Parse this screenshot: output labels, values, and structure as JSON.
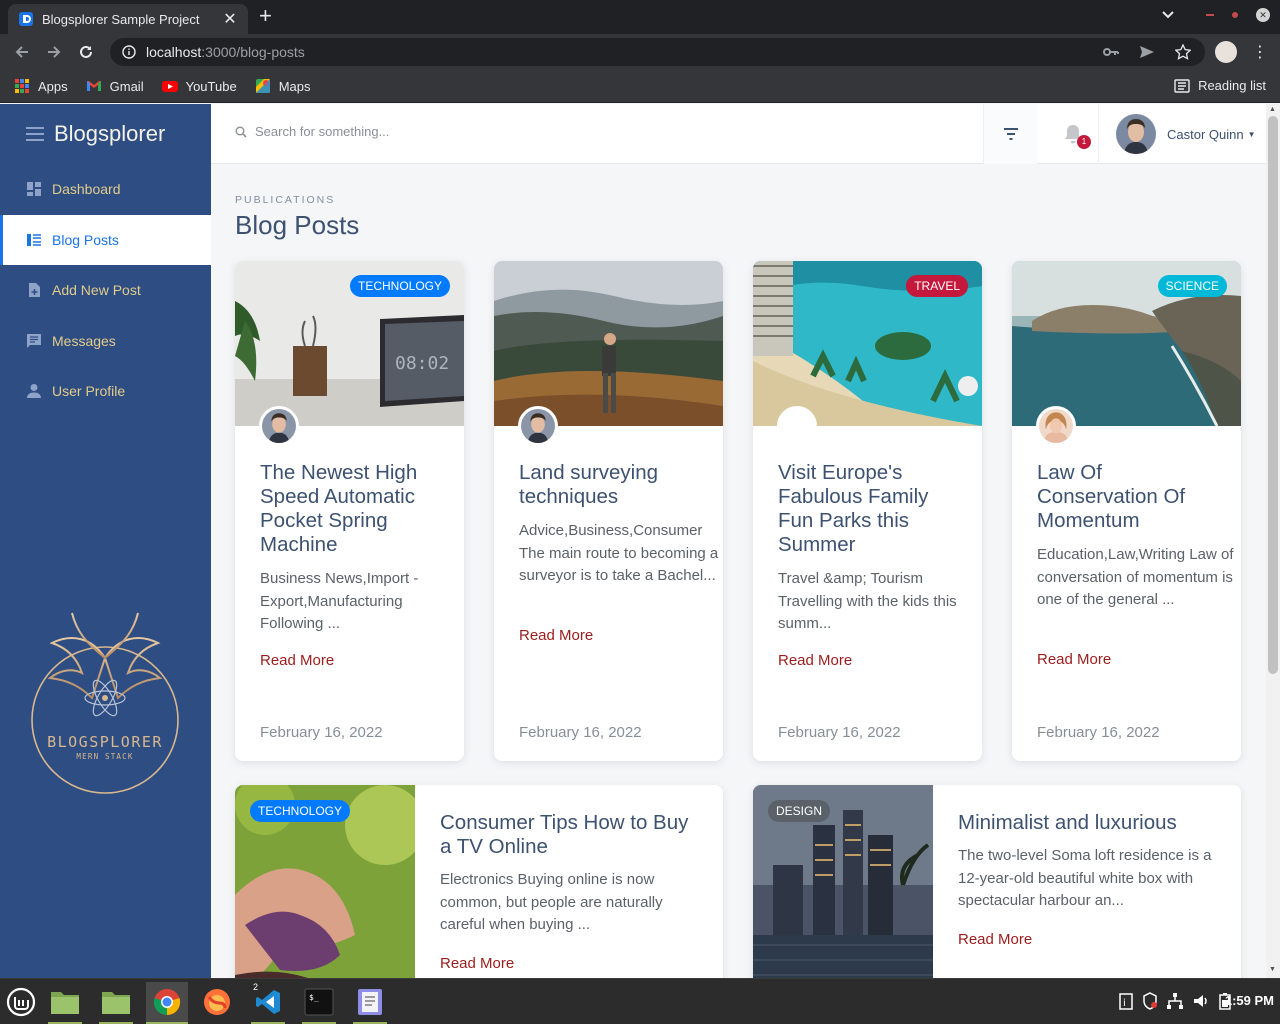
{
  "browser": {
    "tab_title": "Blogsplorer Sample Project",
    "url_host": "localhost",
    "url_path": ":3000/blog-posts",
    "bookmarks": [
      "Apps",
      "Gmail",
      "YouTube",
      "Maps"
    ],
    "reading_list": "Reading list"
  },
  "sidebar": {
    "brand": "Blogsplorer",
    "items": [
      {
        "label": "Dashboard",
        "icon": "dashboard-icon"
      },
      {
        "label": "Blog Posts",
        "icon": "list-icon"
      },
      {
        "label": "Add New Post",
        "icon": "note-add-icon"
      },
      {
        "label": "Messages",
        "icon": "message-icon"
      },
      {
        "label": "User Profile",
        "icon": "person-icon"
      }
    ],
    "logo_text": "BLOGSPLORER",
    "logo_sub": "MERN STACK",
    "active_color": "#1a73e8"
  },
  "topbar": {
    "search_placeholder": "Search for something...",
    "notif_count": "1",
    "user_name": "Castor Quinn"
  },
  "page": {
    "eyebrow": "PUBLICATIONS",
    "title": "Blog Posts"
  },
  "cards": [
    {
      "badge": "TECHNOLOGY",
      "badge_color": "#007bff",
      "title": "The Newest High Speed Automatic Pocket Spring Machine",
      "text": "Business News,Import - Export,Manufacturing Following ...",
      "more": "Read More",
      "date": "February 16, 2022"
    },
    {
      "badge": "",
      "title": "Land surveying techniques",
      "text": "Advice,Business,Consumer The main route to becoming a surveyor is to take a Bachel...",
      "more": "Read More",
      "date": "February 16, 2022"
    },
    {
      "badge": "TRAVEL",
      "badge_color": "#c4183c",
      "title": "Visit Europe's Fabulous Family Fun Parks this Summer",
      "text": "Travel &amp; Tourism Travelling with the kids this summ...",
      "more": "Read More",
      "date": "February 16, 2022"
    },
    {
      "badge": "SCIENCE",
      "badge_color": "#00b8d8",
      "title": "Law Of Conservation Of Momentum",
      "text": "Education,Law,Writing Law of conversation of momentum is one of the general ...",
      "more": "Read More",
      "date": "February 16, 2022"
    }
  ],
  "wide_cards": [
    {
      "badge": "TECHNOLOGY",
      "badge_color": "#007bff",
      "title": "Consumer Tips How to Buy a TV Online",
      "text": "Electronics Buying online is now common, but people are naturally careful when buying ...",
      "more": "Read More"
    },
    {
      "badge": "DESIGN",
      "badge_color": "#5a6169",
      "title": "Minimalist and luxurious",
      "text": "The two-level Soma loft residence is a 12-year-old beautiful white box with spectacular harbour an...",
      "more": "Read More"
    }
  ],
  "taskbar": {
    "clock": "1:59 PM",
    "vscode_count": "2"
  }
}
